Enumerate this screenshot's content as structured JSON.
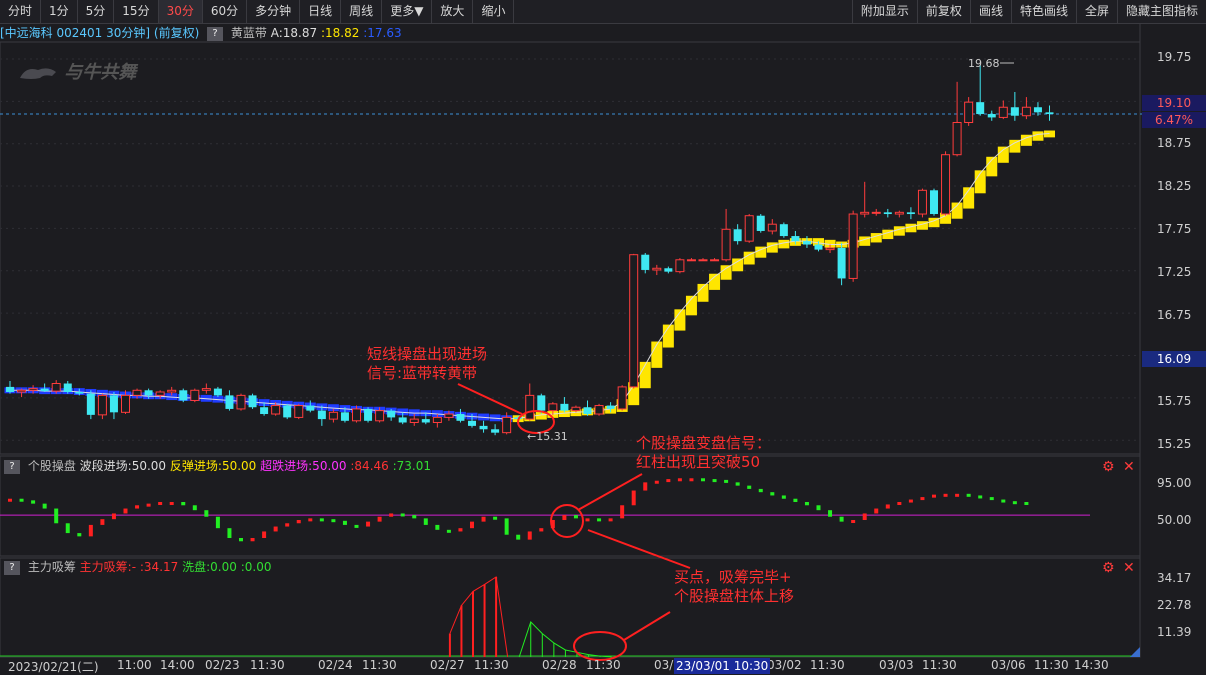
{
  "toolbar": {
    "left": [
      "分时",
      "1分",
      "5分",
      "15分",
      "30分",
      "60分",
      "多分钟",
      "日线",
      "周线",
      "更多▼",
      "放大",
      "缩小"
    ],
    "active_index": 4,
    "right": [
      "附加显示",
      "前复权",
      "画线",
      "特色画线",
      "全屏",
      "隐藏主图指标"
    ]
  },
  "info": {
    "stock": "[中远海科 002401 30分钟] (前复权)",
    "indicator": "黄蓝带",
    "a_label": "A:18.87",
    "y_value": ":18.82",
    "b_value": ":17.63"
  },
  "logo_text": "与牛共舞",
  "main_axis": [
    "19.75",
    "19.25",
    "18.75",
    "18.25",
    "17.75",
    "17.25",
    "16.75",
    "16.25",
    "15.75",
    "15.25"
  ],
  "price_current": "19.10",
  "price_change": "6.47%",
  "price_mark": "16.09",
  "high_label": "19.68",
  "low_label": "15.31",
  "pane2": {
    "name": "个股操盘",
    "s1": "波段进场:50.00",
    "s2": "反弹进场:50.00",
    "s3": "超跌进场:50.00",
    "s4": ":84.46",
    "s5": ":73.01",
    "axis": [
      "95.00",
      "50.00"
    ]
  },
  "pane3": {
    "name": "主力吸筹",
    "s1": "主力吸筹:-",
    "s2": ":34.17",
    "s3": "洗盘:0.00",
    "s4": ":0.00",
    "axis": [
      "34.17",
      "22.78",
      "11.39"
    ]
  },
  "x_axis": [
    "2023/02/21(二)",
    "11:00",
    "14:00",
    "02/23",
    "11:30",
    "02/24",
    "11:30",
    "02/27",
    "11:30",
    "02/28",
    "11:30",
    "03/01",
    "11:30",
    "03/02",
    "11:30",
    "03/03",
    "11:30",
    "03/06",
    "11:30",
    "14:30"
  ],
  "x_highlight": "23/03/01 10:30",
  "annotations": {
    "a1_line1": "短线操盘出现进场",
    "a1_line2": "信号:蓝带转黄带",
    "a2_line1": "个股操盘变盘信号：",
    "a2_line2": "红柱出现且突破50",
    "a3_line1": "买点，吸筹完毕+",
    "a3_line2": "个股操盘柱体上移"
  },
  "chart_data": {
    "type": "candlestick",
    "ylim": [
      15.1,
      19.95
    ],
    "candles": [
      [
        15.88,
        15.95,
        15.8,
        15.82
      ],
      [
        15.82,
        15.86,
        15.76,
        15.84
      ],
      [
        15.84,
        15.9,
        15.8,
        15.86
      ],
      [
        15.86,
        15.92,
        15.82,
        15.83
      ],
      [
        15.83,
        15.96,
        15.8,
        15.92
      ],
      [
        15.92,
        15.95,
        15.8,
        15.82
      ],
      [
        15.82,
        15.86,
        15.78,
        15.8
      ],
      [
        15.8,
        15.84,
        15.5,
        15.55
      ],
      [
        15.55,
        15.8,
        15.5,
        15.78
      ],
      [
        15.78,
        15.82,
        15.5,
        15.58
      ],
      [
        15.58,
        15.84,
        15.56,
        15.78
      ],
      [
        15.78,
        15.86,
        15.74,
        15.84
      ],
      [
        15.84,
        15.86,
        15.74,
        15.78
      ],
      [
        15.78,
        15.84,
        15.74,
        15.82
      ],
      [
        15.82,
        15.88,
        15.78,
        15.84
      ],
      [
        15.84,
        15.86,
        15.7,
        15.72
      ],
      [
        15.72,
        15.86,
        15.7,
        15.84
      ],
      [
        15.84,
        15.92,
        15.8,
        15.86
      ],
      [
        15.86,
        15.88,
        15.76,
        15.78
      ],
      [
        15.78,
        15.84,
        15.6,
        15.62
      ],
      [
        15.62,
        15.8,
        15.6,
        15.78
      ],
      [
        15.78,
        15.8,
        15.62,
        15.64
      ],
      [
        15.64,
        15.7,
        15.54,
        15.56
      ],
      [
        15.56,
        15.7,
        15.54,
        15.66
      ],
      [
        15.66,
        15.68,
        15.5,
        15.52
      ],
      [
        15.52,
        15.68,
        15.5,
        15.66
      ],
      [
        15.66,
        15.72,
        15.58,
        15.6
      ],
      [
        15.6,
        15.66,
        15.42,
        15.5
      ],
      [
        15.5,
        15.62,
        15.46,
        15.58
      ],
      [
        15.58,
        15.64,
        15.46,
        15.48
      ],
      [
        15.48,
        15.66,
        15.46,
        15.62
      ],
      [
        15.62,
        15.64,
        15.46,
        15.48
      ],
      [
        15.48,
        15.64,
        15.46,
        15.6
      ],
      [
        15.6,
        15.62,
        15.48,
        15.52
      ],
      [
        15.52,
        15.58,
        15.44,
        15.46
      ],
      [
        15.46,
        15.56,
        15.42,
        15.5
      ],
      [
        15.5,
        15.58,
        15.44,
        15.46
      ],
      [
        15.46,
        15.56,
        15.4,
        15.52
      ],
      [
        15.52,
        15.6,
        15.48,
        15.56
      ],
      [
        15.56,
        15.62,
        15.46,
        15.48
      ],
      [
        15.48,
        15.56,
        15.4,
        15.42
      ],
      [
        15.42,
        15.48,
        15.34,
        15.38
      ],
      [
        15.38,
        15.44,
        15.31,
        15.34
      ],
      [
        15.34,
        15.58,
        15.32,
        15.52
      ],
      [
        15.52,
        15.54,
        15.46,
        15.5
      ],
      [
        15.5,
        15.92,
        15.48,
        15.78
      ],
      [
        15.78,
        15.8,
        15.56,
        15.6
      ],
      [
        15.6,
        15.7,
        15.55,
        15.68
      ],
      [
        15.68,
        15.76,
        15.58,
        15.6
      ],
      [
        15.6,
        15.66,
        15.58,
        15.64
      ],
      [
        15.64,
        15.72,
        15.54,
        15.56
      ],
      [
        15.56,
        15.68,
        15.54,
        15.66
      ],
      [
        15.66,
        15.7,
        15.58,
        15.62
      ],
      [
        15.62,
        15.9,
        15.6,
        15.88
      ],
      [
        15.88,
        17.45,
        15.86,
        17.44
      ],
      [
        17.44,
        17.46,
        17.22,
        17.26
      ],
      [
        17.26,
        17.32,
        17.2,
        17.28
      ],
      [
        17.28,
        17.3,
        17.22,
        17.24
      ],
      [
        17.24,
        17.4,
        17.22,
        17.38
      ],
      [
        17.38,
        17.4,
        17.38,
        17.38
      ],
      [
        17.38,
        17.4,
        17.38,
        17.38
      ],
      [
        17.38,
        17.4,
        17.38,
        17.38
      ],
      [
        17.38,
        17.98,
        17.36,
        17.74
      ],
      [
        17.74,
        17.8,
        17.56,
        17.6
      ],
      [
        17.6,
        17.92,
        17.58,
        17.9
      ],
      [
        17.9,
        17.92,
        17.7,
        17.72
      ],
      [
        17.72,
        17.86,
        17.68,
        17.8
      ],
      [
        17.8,
        17.82,
        17.64,
        17.66
      ],
      [
        17.66,
        17.72,
        17.56,
        17.6
      ],
      [
        17.6,
        17.66,
        17.52,
        17.56
      ],
      [
        17.56,
        17.6,
        17.48,
        17.5
      ],
      [
        17.5,
        17.56,
        17.46,
        17.52
      ],
      [
        17.52,
        17.58,
        17.08,
        17.16
      ],
      [
        17.16,
        17.96,
        17.12,
        17.92
      ],
      [
        17.92,
        18.3,
        17.88,
        17.94
      ],
      [
        17.94,
        17.98,
        17.9,
        17.94
      ],
      [
        17.94,
        17.98,
        17.88,
        17.92
      ],
      [
        17.92,
        17.96,
        17.88,
        17.94
      ],
      [
        17.94,
        18.0,
        17.86,
        17.92
      ],
      [
        17.92,
        18.22,
        17.88,
        18.2
      ],
      [
        18.2,
        18.22,
        17.9,
        17.92
      ],
      [
        17.92,
        18.66,
        17.9,
        18.62
      ],
      [
        18.62,
        19.48,
        18.6,
        19.0
      ],
      [
        19.0,
        19.3,
        18.96,
        19.24
      ],
      [
        19.24,
        19.68,
        19.08,
        19.1
      ],
      [
        19.1,
        19.14,
        19.02,
        19.06
      ],
      [
        19.06,
        19.26,
        19.04,
        19.18
      ],
      [
        19.18,
        19.36,
        19.02,
        19.08
      ],
      [
        19.08,
        19.3,
        19.04,
        19.18
      ],
      [
        19.18,
        19.24,
        19.08,
        19.12
      ],
      [
        19.12,
        19.2,
        19.02,
        19.1
      ]
    ],
    "band": [
      15.84,
      15.84,
      15.84,
      15.83,
      15.83,
      15.83,
      15.82,
      15.81,
      15.8,
      15.79,
      15.78,
      15.78,
      15.77,
      15.77,
      15.76,
      15.75,
      15.75,
      15.74,
      15.73,
      15.72,
      15.71,
      15.7,
      15.69,
      15.68,
      15.67,
      15.66,
      15.65,
      15.64,
      15.63,
      15.62,
      15.61,
      15.61,
      15.6,
      15.59,
      15.58,
      15.57,
      15.57,
      15.56,
      15.55,
      15.54,
      15.53,
      15.52,
      15.51,
      15.5,
      15.51,
      15.53,
      15.55,
      15.56,
      15.57,
      15.58,
      15.59,
      15.6,
      15.62,
      15.7,
      15.9,
      16.14,
      16.38,
      16.58,
      16.76,
      16.92,
      17.06,
      17.18,
      17.28,
      17.36,
      17.44,
      17.5,
      17.55,
      17.58,
      17.6,
      17.6,
      17.58,
      17.56,
      17.56,
      17.58,
      17.62,
      17.66,
      17.7,
      17.74,
      17.77,
      17.8,
      17.84,
      17.9,
      18.02,
      18.2,
      18.4,
      18.56,
      18.68,
      18.76,
      18.82,
      18.86,
      18.87
    ],
    "band_turn_index": 44,
    "osc": [
      70,
      68,
      64,
      58,
      40,
      28,
      24,
      38,
      45,
      52,
      58,
      62,
      64,
      66,
      66,
      62,
      56,
      48,
      34,
      22,
      18,
      22,
      30,
      36,
      40,
      44,
      46,
      45,
      43,
      38,
      36,
      42,
      48,
      52,
      50,
      46,
      38,
      32,
      30,
      34,
      42,
      48,
      46,
      26,
      20,
      30,
      34,
      44,
      50,
      46,
      46,
      44,
      46,
      62,
      80,
      90,
      92,
      94,
      95,
      95,
      94,
      93,
      90,
      86,
      82,
      78,
      74,
      70,
      66,
      62,
      56,
      48,
      42,
      44,
      52,
      58,
      63,
      66,
      69,
      72,
      75,
      76,
      76,
      74,
      72,
      69,
      67,
      66,
      64
    ]
  }
}
